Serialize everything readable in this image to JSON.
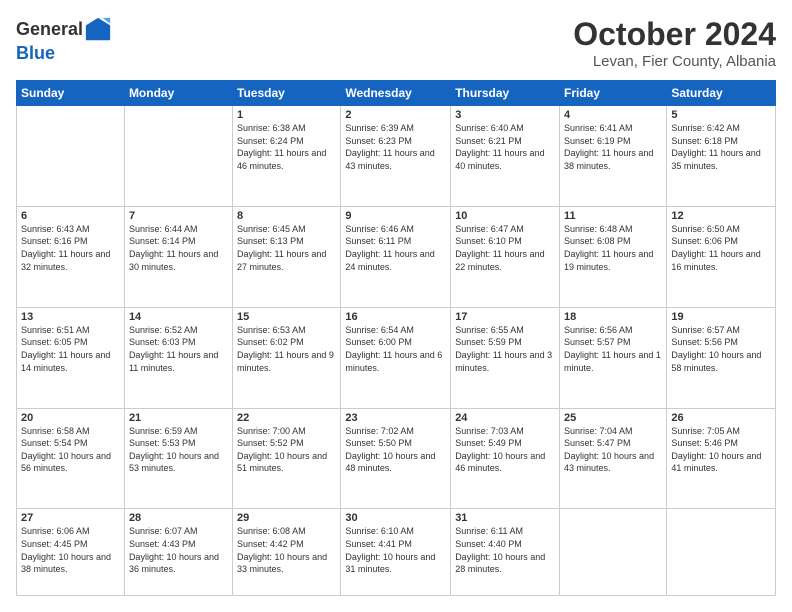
{
  "header": {
    "logo_general": "General",
    "logo_blue": "Blue",
    "month_title": "October 2024",
    "location": "Levan, Fier County, Albania"
  },
  "weekdays": [
    "Sunday",
    "Monday",
    "Tuesday",
    "Wednesday",
    "Thursday",
    "Friday",
    "Saturday"
  ],
  "weeks": [
    [
      {
        "day": "",
        "info": ""
      },
      {
        "day": "",
        "info": ""
      },
      {
        "day": "1",
        "info": "Sunrise: 6:38 AM\nSunset: 6:24 PM\nDaylight: 11 hours and 46 minutes."
      },
      {
        "day": "2",
        "info": "Sunrise: 6:39 AM\nSunset: 6:23 PM\nDaylight: 11 hours and 43 minutes."
      },
      {
        "day": "3",
        "info": "Sunrise: 6:40 AM\nSunset: 6:21 PM\nDaylight: 11 hours and 40 minutes."
      },
      {
        "day": "4",
        "info": "Sunrise: 6:41 AM\nSunset: 6:19 PM\nDaylight: 11 hours and 38 minutes."
      },
      {
        "day": "5",
        "info": "Sunrise: 6:42 AM\nSunset: 6:18 PM\nDaylight: 11 hours and 35 minutes."
      }
    ],
    [
      {
        "day": "6",
        "info": "Sunrise: 6:43 AM\nSunset: 6:16 PM\nDaylight: 11 hours and 32 minutes."
      },
      {
        "day": "7",
        "info": "Sunrise: 6:44 AM\nSunset: 6:14 PM\nDaylight: 11 hours and 30 minutes."
      },
      {
        "day": "8",
        "info": "Sunrise: 6:45 AM\nSunset: 6:13 PM\nDaylight: 11 hours and 27 minutes."
      },
      {
        "day": "9",
        "info": "Sunrise: 6:46 AM\nSunset: 6:11 PM\nDaylight: 11 hours and 24 minutes."
      },
      {
        "day": "10",
        "info": "Sunrise: 6:47 AM\nSunset: 6:10 PM\nDaylight: 11 hours and 22 minutes."
      },
      {
        "day": "11",
        "info": "Sunrise: 6:48 AM\nSunset: 6:08 PM\nDaylight: 11 hours and 19 minutes."
      },
      {
        "day": "12",
        "info": "Sunrise: 6:50 AM\nSunset: 6:06 PM\nDaylight: 11 hours and 16 minutes."
      }
    ],
    [
      {
        "day": "13",
        "info": "Sunrise: 6:51 AM\nSunset: 6:05 PM\nDaylight: 11 hours and 14 minutes."
      },
      {
        "day": "14",
        "info": "Sunrise: 6:52 AM\nSunset: 6:03 PM\nDaylight: 11 hours and 11 minutes."
      },
      {
        "day": "15",
        "info": "Sunrise: 6:53 AM\nSunset: 6:02 PM\nDaylight: 11 hours and 9 minutes."
      },
      {
        "day": "16",
        "info": "Sunrise: 6:54 AM\nSunset: 6:00 PM\nDaylight: 11 hours and 6 minutes."
      },
      {
        "day": "17",
        "info": "Sunrise: 6:55 AM\nSunset: 5:59 PM\nDaylight: 11 hours and 3 minutes."
      },
      {
        "day": "18",
        "info": "Sunrise: 6:56 AM\nSunset: 5:57 PM\nDaylight: 11 hours and 1 minute."
      },
      {
        "day": "19",
        "info": "Sunrise: 6:57 AM\nSunset: 5:56 PM\nDaylight: 10 hours and 58 minutes."
      }
    ],
    [
      {
        "day": "20",
        "info": "Sunrise: 6:58 AM\nSunset: 5:54 PM\nDaylight: 10 hours and 56 minutes."
      },
      {
        "day": "21",
        "info": "Sunrise: 6:59 AM\nSunset: 5:53 PM\nDaylight: 10 hours and 53 minutes."
      },
      {
        "day": "22",
        "info": "Sunrise: 7:00 AM\nSunset: 5:52 PM\nDaylight: 10 hours and 51 minutes."
      },
      {
        "day": "23",
        "info": "Sunrise: 7:02 AM\nSunset: 5:50 PM\nDaylight: 10 hours and 48 minutes."
      },
      {
        "day": "24",
        "info": "Sunrise: 7:03 AM\nSunset: 5:49 PM\nDaylight: 10 hours and 46 minutes."
      },
      {
        "day": "25",
        "info": "Sunrise: 7:04 AM\nSunset: 5:47 PM\nDaylight: 10 hours and 43 minutes."
      },
      {
        "day": "26",
        "info": "Sunrise: 7:05 AM\nSunset: 5:46 PM\nDaylight: 10 hours and 41 minutes."
      }
    ],
    [
      {
        "day": "27",
        "info": "Sunrise: 6:06 AM\nSunset: 4:45 PM\nDaylight: 10 hours and 38 minutes."
      },
      {
        "day": "28",
        "info": "Sunrise: 6:07 AM\nSunset: 4:43 PM\nDaylight: 10 hours and 36 minutes."
      },
      {
        "day": "29",
        "info": "Sunrise: 6:08 AM\nSunset: 4:42 PM\nDaylight: 10 hours and 33 minutes."
      },
      {
        "day": "30",
        "info": "Sunrise: 6:10 AM\nSunset: 4:41 PM\nDaylight: 10 hours and 31 minutes."
      },
      {
        "day": "31",
        "info": "Sunrise: 6:11 AM\nSunset: 4:40 PM\nDaylight: 10 hours and 28 minutes."
      },
      {
        "day": "",
        "info": ""
      },
      {
        "day": "",
        "info": ""
      }
    ]
  ]
}
